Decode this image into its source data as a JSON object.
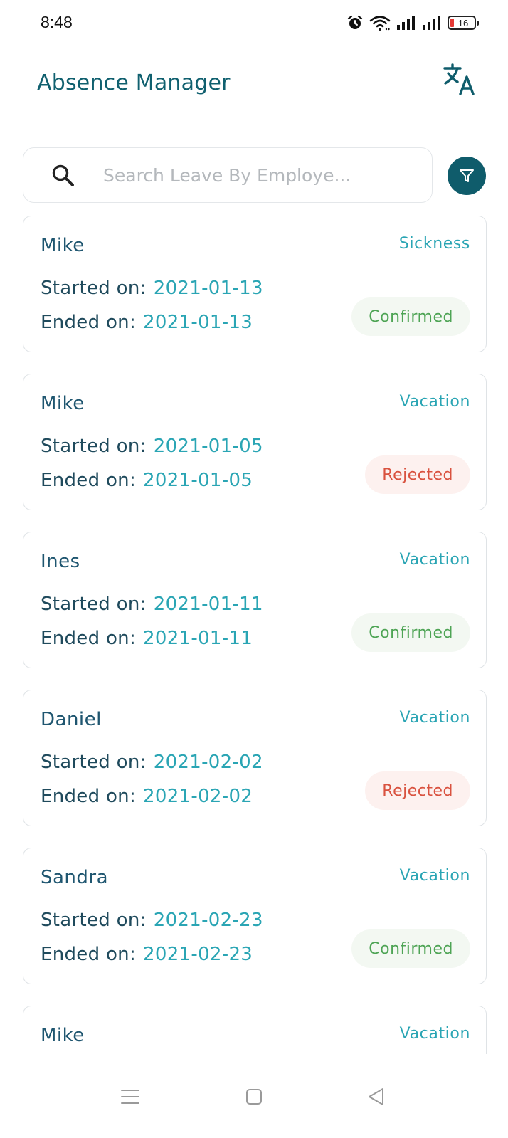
{
  "status_bar": {
    "time": "8:48",
    "battery_level": "16",
    "icons": [
      "alarm-icon",
      "wifi-icon",
      "signal-icon",
      "signal-icon",
      "battery-icon"
    ]
  },
  "header": {
    "title": "Absence Manager",
    "translate_icon": "translate-icon"
  },
  "search": {
    "placeholder": "Search Leave By Employe...",
    "value": "",
    "filter_icon": "filter-icon"
  },
  "labels": {
    "started_on": "Started on:",
    "ended_on": "Ended on:"
  },
  "leaves": [
    {
      "name": "Mike",
      "type": "Sickness",
      "start": "2021-01-13",
      "end": "2021-01-13",
      "status": "Confirmed"
    },
    {
      "name": "Mike",
      "type": "Vacation",
      "start": "2021-01-05",
      "end": "2021-01-05",
      "status": "Rejected"
    },
    {
      "name": "Ines",
      "type": "Vacation",
      "start": "2021-01-11",
      "end": "2021-01-11",
      "status": "Confirmed"
    },
    {
      "name": "Daniel",
      "type": "Vacation",
      "start": "2021-02-02",
      "end": "2021-02-02",
      "status": "Rejected"
    },
    {
      "name": "Sandra",
      "type": "Vacation",
      "start": "2021-02-23",
      "end": "2021-02-23",
      "status": "Confirmed"
    },
    {
      "name": "Mike",
      "type": "Vacation",
      "start": "",
      "end": "",
      "status": ""
    }
  ],
  "colors": {
    "primary": "#0f5c6b",
    "accent": "#2aa5b4",
    "confirmed": "#4ea455",
    "rejected": "#d9523f"
  },
  "nav_bar": {
    "icons": [
      "menu-icon",
      "home-icon",
      "back-icon"
    ]
  }
}
